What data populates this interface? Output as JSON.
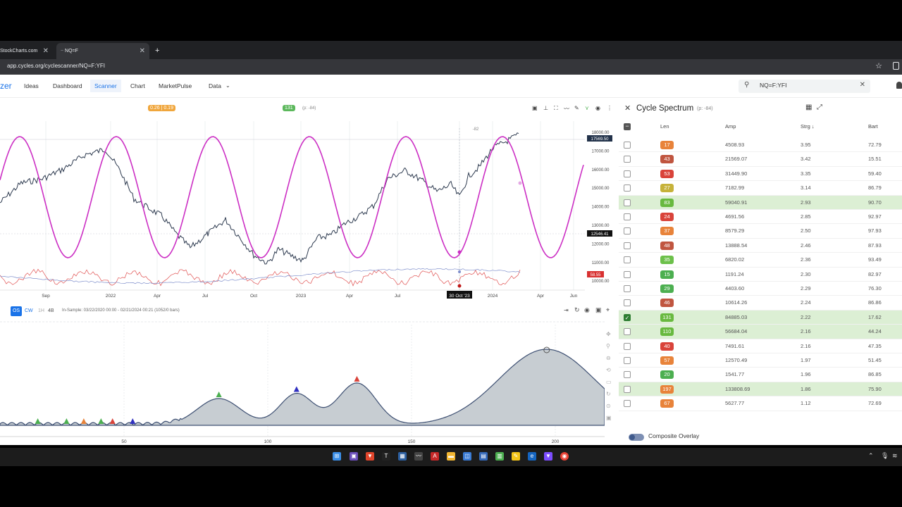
{
  "browser": {
    "tabs": [
      {
        "label": "StockCharts.com"
      },
      {
        "label": "NQ=F"
      }
    ],
    "new_tab": "+",
    "url": "app.cycles.org/cyclescanner/NQ=F:YFI"
  },
  "nav": {
    "brand": "zer",
    "items": [
      "Ideas",
      "Dashboard",
      "Scanner",
      "Chart",
      "MarketPulse",
      "Data"
    ],
    "active": "Scanner",
    "search_value": "NQ=F:YFI"
  },
  "chart": {
    "badge_left": "0.26 | 0.19",
    "badge_cycle": "131",
    "badge_cycle_sub": "(p: -84)",
    "marker_label": "-82",
    "price_labels": [
      "18000.00",
      "17000.00",
      "16000.00",
      "15000.00",
      "14000.00",
      "13000.00",
      "12000.00",
      "11000.00",
      "10000.00"
    ],
    "price_current": "17569.50",
    "price_cursor": "12546.41",
    "osc_value": "58.55",
    "x_labels": [
      "Sep",
      "2022",
      "Apr",
      "Jul",
      "Oct",
      "2023",
      "Apr",
      "Jul",
      "30 Oct '23",
      "2024",
      "Apr",
      "Jun"
    ],
    "bottom_bar": {
      "buttons": [
        "OS",
        "CW",
        "1H",
        "4B"
      ],
      "sample_text": "In-Sample: 03/22/2020 00:00 - 02/21/2024 00:21 (1052/0 bars)"
    }
  },
  "spectrum": {
    "x_labels": [
      "50",
      "100",
      "150",
      "200"
    ]
  },
  "sidebar": {
    "title": "Cycle Spectrum",
    "subtitle": "(p: -84)",
    "columns": {
      "len": "Len",
      "amp": "Amp",
      "strg": "Strg ↓",
      "bart": "Bart"
    },
    "rows": [
      {
        "len": "17",
        "amp": "4508.93",
        "strg": "3.95",
        "bart": "72.79",
        "color": "#e8833a",
        "hl": false,
        "checked": false
      },
      {
        "len": "43",
        "amp": "21569.07",
        "strg": "3.42",
        "bart": "15.51",
        "color": "#c0553f",
        "hl": false,
        "checked": false
      },
      {
        "len": "53",
        "amp": "31449.90",
        "strg": "3.35",
        "bart": "59.40",
        "color": "#d9433a",
        "hl": false,
        "checked": false
      },
      {
        "len": "27",
        "amp": "7182.99",
        "strg": "3.14",
        "bart": "86.79",
        "color": "#c6b23a",
        "hl": false,
        "checked": false
      },
      {
        "len": "83",
        "amp": "59040.91",
        "strg": "2.93",
        "bart": "90.70",
        "color": "#68b93f",
        "hl": true,
        "checked": false
      },
      {
        "len": "24",
        "amp": "4691.56",
        "strg": "2.85",
        "bart": "92.97",
        "color": "#d9433a",
        "hl": false,
        "checked": false
      },
      {
        "len": "37",
        "amp": "8579.29",
        "strg": "2.50",
        "bart": "97.93",
        "color": "#e8833a",
        "hl": false,
        "checked": false
      },
      {
        "len": "48",
        "amp": "13888.54",
        "strg": "2.46",
        "bart": "87.93",
        "color": "#c0553f",
        "hl": false,
        "checked": false
      },
      {
        "len": "35",
        "amp": "6820.02",
        "strg": "2.36",
        "bart": "93.49",
        "color": "#6cc04a",
        "hl": false,
        "checked": false
      },
      {
        "len": "15",
        "amp": "1191.24",
        "strg": "2.30",
        "bart": "82.97",
        "color": "#4caf50",
        "hl": false,
        "checked": false
      },
      {
        "len": "29",
        "amp": "4403.60",
        "strg": "2.29",
        "bart": "76.30",
        "color": "#4caf50",
        "hl": false,
        "checked": false
      },
      {
        "len": "46",
        "amp": "10614.26",
        "strg": "2.24",
        "bart": "86.86",
        "color": "#c0553f",
        "hl": false,
        "checked": false
      },
      {
        "len": "131",
        "amp": "84885.03",
        "strg": "2.22",
        "bart": "17.62",
        "color": "#68b93f",
        "hl": true,
        "checked": true
      },
      {
        "len": "110",
        "amp": "56684.04",
        "strg": "2.16",
        "bart": "44.24",
        "color": "#68b93f",
        "hl": true,
        "checked": false
      },
      {
        "len": "40",
        "amp": "7491.61",
        "strg": "2.16",
        "bart": "47.35",
        "color": "#d9433a",
        "hl": false,
        "checked": false
      },
      {
        "len": "57",
        "amp": "12570.49",
        "strg": "1.97",
        "bart": "51.45",
        "color": "#e8833a",
        "hl": false,
        "checked": false
      },
      {
        "len": "20",
        "amp": "1541.77",
        "strg": "1.96",
        "bart": "86.85",
        "color": "#4caf50",
        "hl": false,
        "checked": false
      },
      {
        "len": "197",
        "amp": "133808.69",
        "strg": "1.86",
        "bart": "75.90",
        "color": "#e8833a",
        "hl": true,
        "checked": false
      },
      {
        "len": "67",
        "amp": "5627.77",
        "strg": "1.12",
        "bart": "72.69",
        "color": "#e8833a",
        "hl": false,
        "checked": false
      }
    ],
    "overlay_label": "Composite Overlay"
  }
}
